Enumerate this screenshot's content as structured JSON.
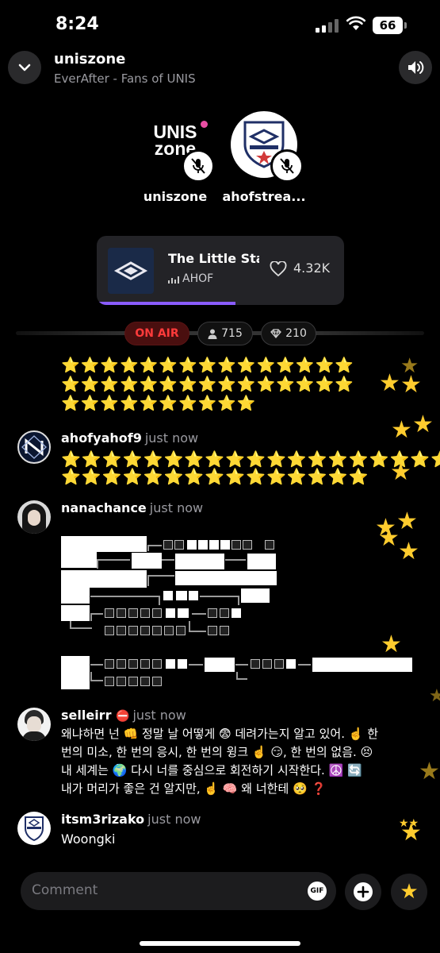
{
  "status_bar": {
    "time": "8:24",
    "battery": "66"
  },
  "header": {
    "title": "uniszone",
    "subtitle": "EverAfter - Fans of UNIS"
  },
  "hosts": [
    {
      "name": "uniszone",
      "logo_line1": "UNIS",
      "logo_line2": "zone"
    },
    {
      "name": "ahofstrea..."
    }
  ],
  "now_playing": {
    "title": "The Little Star",
    "artist": "AHOF",
    "likes": "4.32K",
    "progress": 0.56
  },
  "stats": {
    "on_air": "ON AIR",
    "listeners": "715",
    "gems": "210"
  },
  "chat": [
    {
      "user": "ahofyahof9",
      "time": "just now",
      "text": ""
    },
    {
      "user": "nanachance",
      "time": "just now",
      "text": ""
    },
    {
      "user": "selleirr",
      "time": "just now",
      "lines": [
        "왜냐하면 넌 👊 정말 날 어떻게 😨 데려가는지 알고 있어. ☝️ 한",
        "번의 미소, 한 번의 응시, 한 번의 윙크 ☝️ 😏, 한 번의 없음. 😣",
        "내 세계는 🌍 다시 너를 중심으로 회전하기 시작한다. ☮️ 🔄",
        "내가 머리가 좋은 건 알지만, ☝️ 🧠 왜 너한테 🥺 ❓"
      ]
    },
    {
      "user": "itsm3rizako",
      "time": "just now",
      "text": "Woongki"
    }
  ],
  "composer": {
    "placeholder": "Comment",
    "gif_label": "GIF"
  },
  "colors": {
    "accent": "#8a5cff",
    "on_air": "#ff3b3b",
    "star": "#ffcc2e"
  }
}
